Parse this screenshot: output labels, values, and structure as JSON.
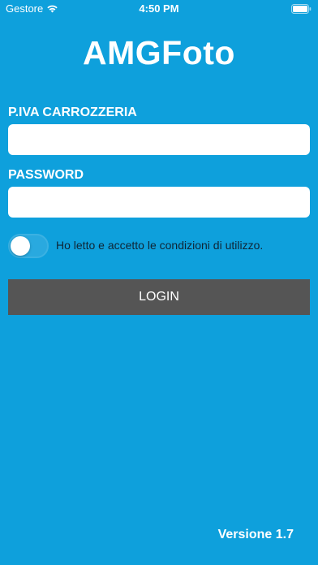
{
  "status_bar": {
    "carrier": "Gestore",
    "time": "4:50 PM",
    "wifi_icon": "wifi-icon",
    "battery_icon": "battery-icon"
  },
  "app": {
    "title": "AMGFoto",
    "background_color": "#0ea0dc"
  },
  "form": {
    "piva_label": "P.IVA CARROZZERIA",
    "piva_value": "",
    "password_label": "PASSWORD",
    "password_value": "",
    "terms_toggle_on": false,
    "terms_text": "Ho letto e accetto le condizioni di utilizzo.",
    "login_label": "LOGIN",
    "login_button_color": "#555555"
  },
  "footer": {
    "version": "Versione 1.7"
  }
}
